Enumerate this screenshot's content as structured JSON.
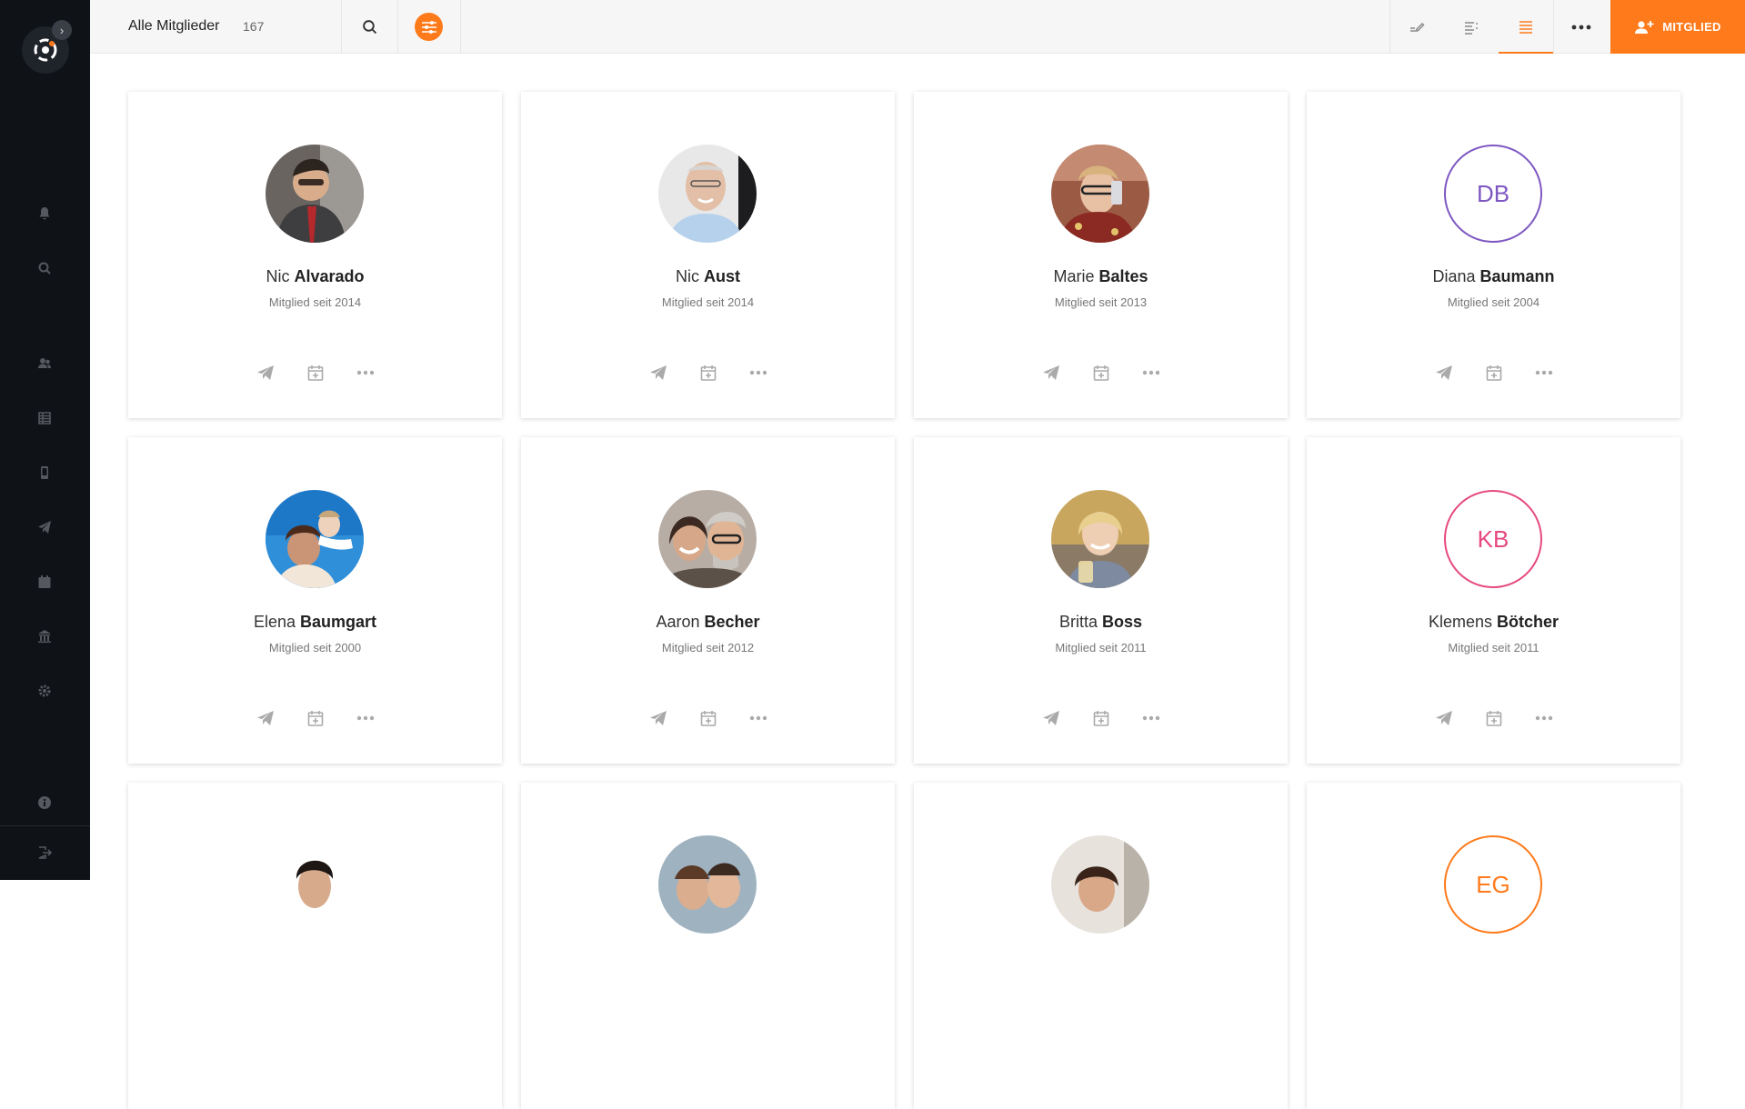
{
  "header": {
    "title": "Alle Mitglieder",
    "count": "167",
    "add_label": "MITGLIED"
  },
  "colors": {
    "accent": "#ff7a1a",
    "sidebar": "#0f1216",
    "purple": "#7e57c2",
    "pink": "#e64980"
  },
  "sidebar": {
    "icons": [
      "bell-icon",
      "search-icon",
      "members-icon",
      "table-icon",
      "device-icon",
      "send-icon",
      "calendar-icon",
      "bank-icon",
      "gear-icon",
      "info-icon",
      "logout-icon"
    ]
  },
  "members": [
    {
      "first": "Nic",
      "last": "Alvarado",
      "since": "Mitglied seit 2014",
      "initials": "",
      "photo": "man-glasses-suit"
    },
    {
      "first": "Nic",
      "last": "Aust",
      "since": "Mitglied seit 2014",
      "initials": "",
      "photo": "man-bald-smile"
    },
    {
      "first": "Marie",
      "last": "Baltes",
      "since": "Mitglied seit 2013",
      "initials": "",
      "photo": "woman-phone"
    },
    {
      "first": "Diana",
      "last": "Baumann",
      "since": "Mitglied seit 2004",
      "initials": "DB",
      "initials_color": "#7e57c2"
    },
    {
      "first": "Elena",
      "last": "Baumgart",
      "since": "Mitglied seit 2000",
      "initials": "",
      "photo": "woman-child-sky"
    },
    {
      "first": "Aaron",
      "last": "Becher",
      "since": "Mitglied seit 2012",
      "initials": "",
      "photo": "couple-smiling"
    },
    {
      "first": "Britta",
      "last": "Boss",
      "since": "Mitglied seit 2011",
      "initials": "",
      "photo": "woman-blonde-drink"
    },
    {
      "first": "Klemens",
      "last": "Bötcher",
      "since": "Mitglied seit 2011",
      "initials": "KB",
      "initials_color": "#e64980"
    }
  ],
  "partial_row": [
    {
      "photo": "man-dark-hair"
    },
    {
      "photo": "couple-outdoor"
    },
    {
      "photo": "woman-window"
    },
    {
      "initials": "EG",
      "initials_color": "#ff7a1a"
    }
  ]
}
